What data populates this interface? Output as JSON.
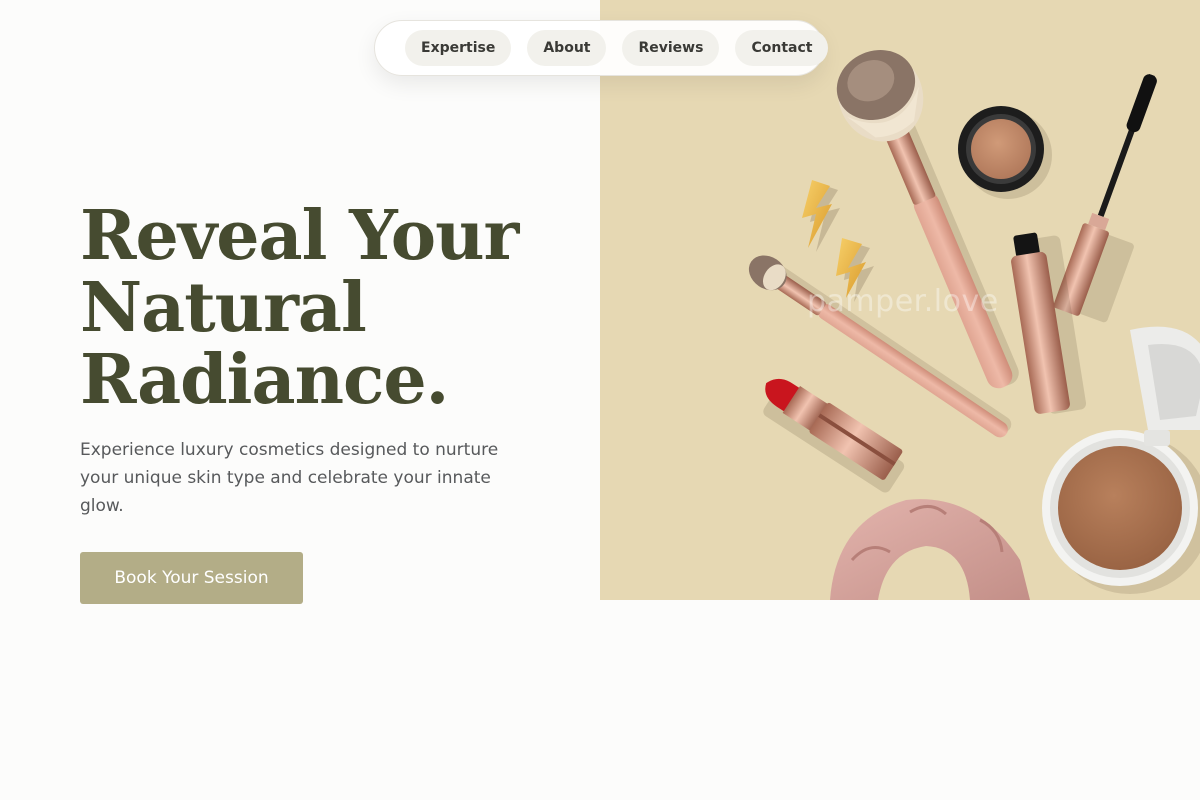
{
  "nav": {
    "items": [
      {
        "label": "Expertise"
      },
      {
        "label": "About"
      },
      {
        "label": "Reviews"
      },
      {
        "label": "Contact"
      }
    ]
  },
  "hero": {
    "title_lines": [
      "Reveal Your",
      "Natural",
      "Radiance."
    ],
    "subtitle": "Experience luxury cosmetics designed to nurture your unique skin type and celebrate your innate glow.",
    "cta_label": "Book Your Session"
  },
  "image": {
    "watermark": "pamper.love",
    "background_color": "#e6d8b3",
    "objects": [
      "kabuki-brush-icon",
      "eyeshadow-pot-icon",
      "mascara-wand-icon",
      "mascara-tube-icon",
      "lightning-earring-icon",
      "blending-brush-icon",
      "lipstick-icon",
      "compact-powder-icon",
      "scrunchie-icon"
    ]
  },
  "colors": {
    "page_background": "#fcfcfb",
    "heading": "#464b30",
    "body_text": "#57595b",
    "cta_background": "#b3ad87",
    "nav_chip": "#f2f1ec"
  }
}
